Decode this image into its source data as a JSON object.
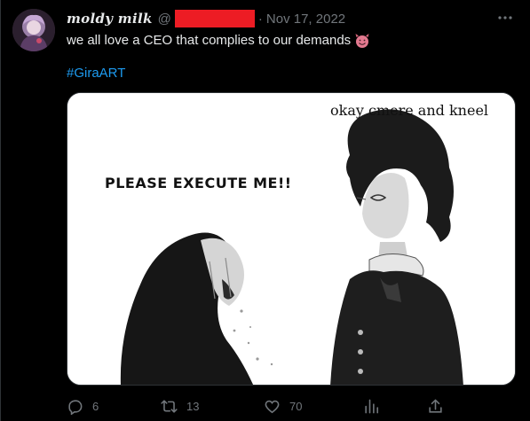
{
  "tweet": {
    "author": {
      "display_name": "moldy milk",
      "handle_prefix": "@",
      "avatar": "anime-avatar"
    },
    "separator": "·",
    "date": "Nov 17, 2022",
    "more_icon": "more-icon",
    "text": "we all love a CEO that complies to our demands",
    "emoji": "smiling-face-with-horns",
    "hashtag": "#GiraART",
    "media": {
      "left_caption": "PLEASE EXECUTE ME!!",
      "right_caption": "okay cmere and kneel"
    },
    "actions": {
      "reply": {
        "icon": "reply-icon",
        "count": "6"
      },
      "retweet": {
        "icon": "retweet-icon",
        "count": "13"
      },
      "like": {
        "icon": "heart-icon",
        "count": "70"
      },
      "analytics": {
        "icon": "analytics-icon"
      },
      "share": {
        "icon": "share-icon"
      }
    },
    "colors": {
      "background": "#000000",
      "text": "#e7e9ea",
      "secondary": "#71767b",
      "link": "#1d9bf0",
      "redaction": "#ed1c24"
    }
  }
}
